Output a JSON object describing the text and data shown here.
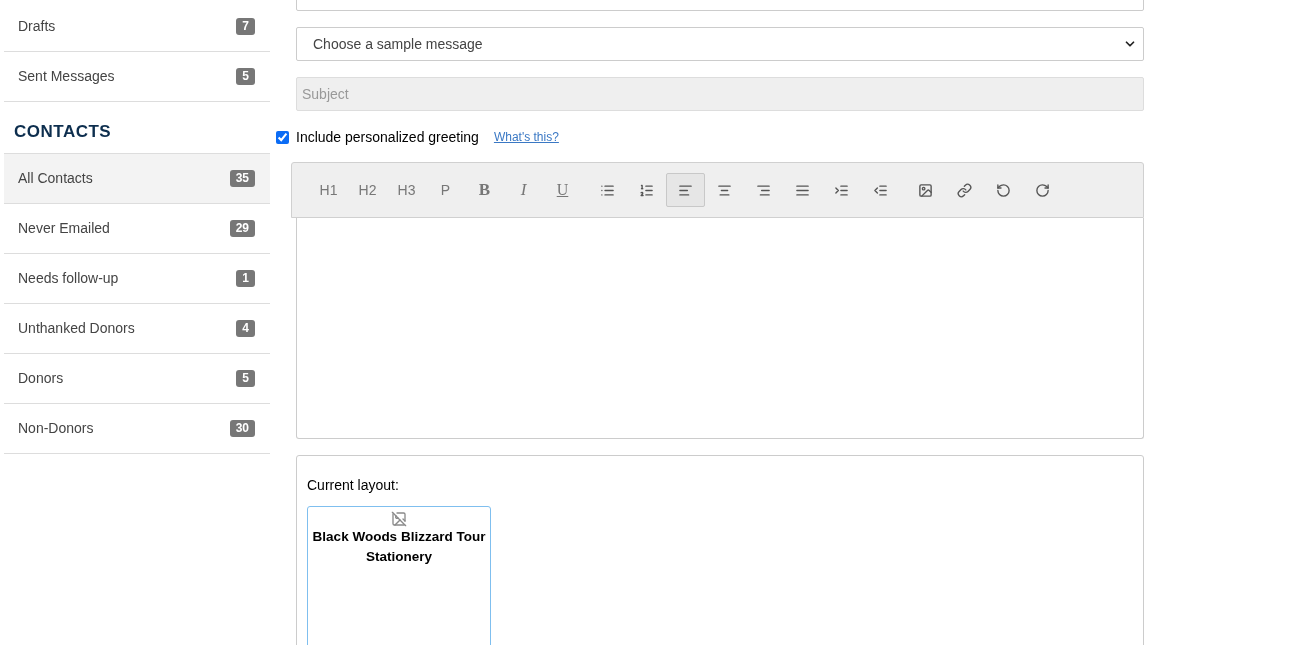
{
  "sidebar": {
    "top_items": [
      {
        "label": "Drafts",
        "count": "7",
        "selected": false
      },
      {
        "label": "Sent Messages",
        "count": "5",
        "selected": false
      }
    ],
    "contacts_heading": "CONTACTS",
    "contacts": [
      {
        "label": "All Contacts",
        "count": "35",
        "selected": true
      },
      {
        "label": "Never Emailed",
        "count": "29",
        "selected": false
      },
      {
        "label": "Needs follow-up",
        "count": "1",
        "selected": false
      },
      {
        "label": "Unthanked Donors",
        "count": "4",
        "selected": false
      },
      {
        "label": "Donors",
        "count": "5",
        "selected": false
      },
      {
        "label": "Non-Donors",
        "count": "30",
        "selected": false
      }
    ]
  },
  "compose": {
    "sample_select": "Choose a sample message",
    "subject": {
      "placeholder": "Subject",
      "disabled": true
    },
    "greeting": {
      "label": "Include personalized greeting",
      "checked": true,
      "help_link": "What's this?"
    },
    "toolbar_groups": [
      [
        {
          "kind": "heading",
          "label": "H1",
          "selected": false
        },
        {
          "kind": "heading",
          "label": "H2",
          "selected": false
        },
        {
          "kind": "heading",
          "label": "H3",
          "selected": false
        },
        {
          "kind": "heading",
          "label": "P",
          "selected": false
        },
        {
          "kind": "bold",
          "label": "B",
          "selected": false
        },
        {
          "kind": "italic",
          "label": "I",
          "selected": false
        },
        {
          "kind": "underline",
          "label": "U",
          "selected": false
        }
      ],
      [
        {
          "kind": "bullet-list",
          "selected": false
        },
        {
          "kind": "numbered-list",
          "selected": false
        },
        {
          "kind": "align-left",
          "selected": true
        },
        {
          "kind": "align-center",
          "selected": false
        },
        {
          "kind": "align-right",
          "selected": false
        },
        {
          "kind": "align-justify",
          "selected": false
        },
        {
          "kind": "indent",
          "selected": false
        },
        {
          "kind": "outdent",
          "selected": false
        }
      ],
      [
        {
          "kind": "image",
          "selected": false
        },
        {
          "kind": "link",
          "selected": false
        },
        {
          "kind": "undo",
          "selected": false
        },
        {
          "kind": "redo",
          "selected": false
        }
      ]
    ],
    "layout": {
      "label": "Current layout:",
      "card_title": "Black Woods Blizzard Tour Stationery"
    }
  }
}
